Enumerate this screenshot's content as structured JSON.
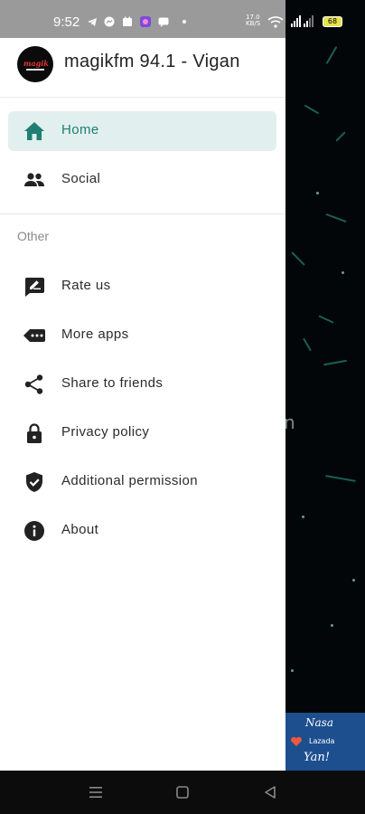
{
  "status_bar": {
    "time": "9:52",
    "network_speed_top": "17.0",
    "network_speed_bottom": "KB/S",
    "battery": "68"
  },
  "drawer": {
    "app_title": "magikfm 94.1 - Vigan",
    "logo_text": "magik",
    "primary_items": [
      {
        "label": "Home",
        "icon": "home-icon",
        "active": true
      },
      {
        "label": "Social",
        "icon": "people-icon",
        "active": false
      }
    ],
    "section_label": "Other",
    "other_items": [
      {
        "label": "Rate us",
        "icon": "rate-icon"
      },
      {
        "label": "More apps",
        "icon": "more-apps-icon"
      },
      {
        "label": "Share to friends",
        "icon": "share-icon"
      },
      {
        "label": "Privacy policy",
        "icon": "lock-icon"
      },
      {
        "label": "Additional permission",
        "icon": "shield-check-icon"
      },
      {
        "label": "About",
        "icon": "info-icon"
      }
    ]
  },
  "background_app": {
    "partial_letter": "n",
    "promo": {
      "line1": "Nasa",
      "line2": "Lazada",
      "line3": "Yan!"
    }
  },
  "colors": {
    "accent": "#1e7f72",
    "active_bg": "#e1efef",
    "drawer_bg": "#ffffff",
    "status_bar_bg": "#9a9a9a"
  }
}
